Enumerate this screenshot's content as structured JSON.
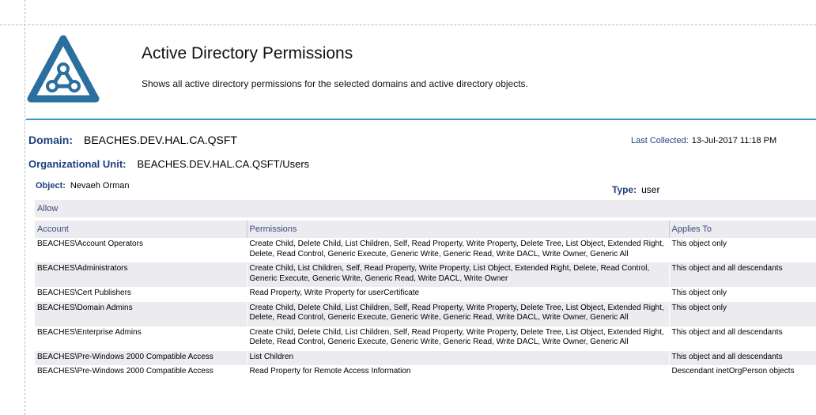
{
  "header": {
    "title": "Active Directory Permissions",
    "subtitle": "Shows all active directory permissions for the selected domains and active directory objects."
  },
  "report": {
    "domain_label": "Domain:",
    "domain_value": "BEACHES.DEV.HAL.CA.QSFT",
    "ou_label": "Organizational Unit:",
    "ou_value": "BEACHES.DEV.HAL.CA.QSFT/Users",
    "object_label": "Object:",
    "object_value": "Nevaeh Orman",
    "last_collected_label": "Last Collected:",
    "last_collected_value": "13-Jul-2017 11:18 PM",
    "type_label": "Type:",
    "type_value": "user"
  },
  "table": {
    "group_label": "Allow",
    "columns": [
      "Account",
      "Permissions",
      "Applies To"
    ],
    "rows": [
      {
        "account": "BEACHES\\Account Operators",
        "permissions": "Create Child, Delete Child, List Children, Self, Read Property, Write Property, Delete Tree, List Object, Extended Right, Delete, Read Control, Generic Execute, Generic Write, Generic Read, Write DACL, Write Owner, Generic All",
        "applies_to": "This object only"
      },
      {
        "account": "BEACHES\\Administrators",
        "permissions": "Create Child, List Children, Self, Read Property, Write Property, List Object, Extended Right, Delete, Read Control, Generic Execute, Generic Write, Generic Read, Write DACL, Write Owner",
        "applies_to": "This object and all descendants"
      },
      {
        "account": "BEACHES\\Cert Publishers",
        "permissions": "Read Property, Write Property for userCertificate",
        "applies_to": "This object only"
      },
      {
        "account": "BEACHES\\Domain Admins",
        "permissions": "Create Child, Delete Child, List Children, Self, Read Property, Write Property, Delete Tree, List Object, Extended Right, Delete, Read Control, Generic Execute, Generic Write, Generic Read, Write DACL, Write Owner, Generic All",
        "applies_to": "This object only"
      },
      {
        "account": "BEACHES\\Enterprise Admins",
        "permissions": "Create Child, Delete Child, List Children, Self, Read Property, Write Property, Delete Tree, List Object, Extended Right, Delete, Read Control, Generic Execute, Generic Write, Generic Read, Write DACL, Write Owner, Generic All",
        "applies_to": "This object and all descendants"
      },
      {
        "account": "BEACHES\\Pre-Windows 2000 Compatible Access",
        "permissions": "List Children",
        "applies_to": "This object and all descendants"
      },
      {
        "account": "BEACHES\\Pre-Windows 2000 Compatible Access",
        "permissions": "Read Property for Remote Access Information",
        "applies_to": "Descendant inetOrgPerson objects"
      }
    ]
  },
  "colors": {
    "accent": "#2a6f9e",
    "label": "#1f3f7f",
    "rule": "#3a97c9",
    "row_alt": "#ebebf0"
  },
  "icons": {
    "logo": "triangle-logo-icon"
  }
}
